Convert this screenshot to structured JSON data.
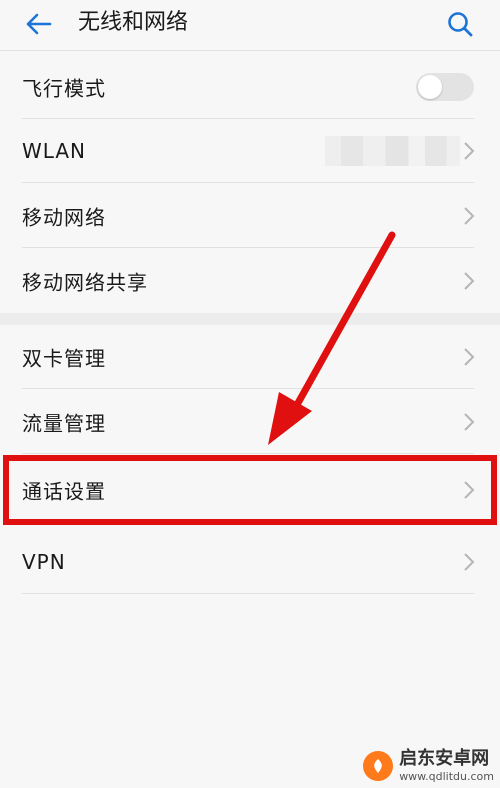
{
  "header": {
    "title": "无线和网络",
    "back_icon": "arrow-left-icon",
    "search_icon": "search-icon",
    "accent": "#1e73d6"
  },
  "items": [
    {
      "label": "飞行模式",
      "control": "toggle",
      "toggle_state": "off"
    },
    {
      "label": "WLAN",
      "control": "chevron"
    },
    {
      "label": "移动网络",
      "control": "chevron"
    },
    {
      "label": "移动网络共享",
      "control": "chevron"
    },
    {
      "label": "双卡管理",
      "control": "chevron"
    },
    {
      "label": "流量管理",
      "control": "chevron"
    },
    {
      "label": "通话设置",
      "control": "chevron",
      "highlighted": true
    },
    {
      "label": "VPN",
      "control": "chevron"
    }
  ],
  "annotation": {
    "highlight_color": "#e01010",
    "arrow_icon": "red-arrow"
  },
  "watermark": {
    "name": "启东安卓网",
    "url": "www.qdlitdu.com"
  }
}
